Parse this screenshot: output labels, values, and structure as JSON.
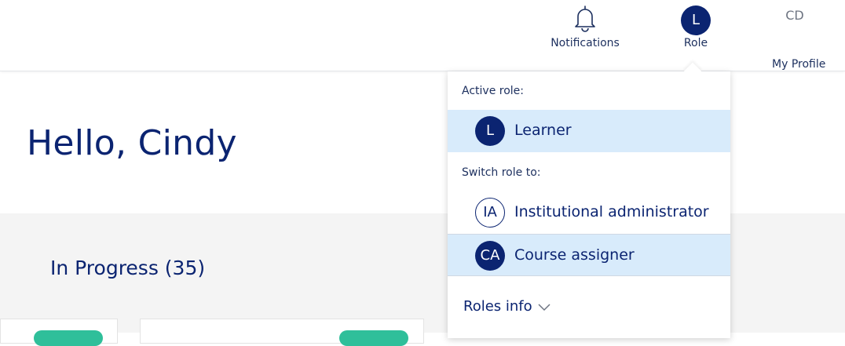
{
  "header": {
    "notifications_label": "Notifications",
    "role_initial": "L",
    "role_label": "Role",
    "profile_initials": "CD",
    "profile_label": "My Profile"
  },
  "greeting": "Hello, Cindy",
  "in_progress": {
    "title": "In Progress (35)"
  },
  "role_menu": {
    "active_heading": "Active role:",
    "active_role": {
      "initials": "L",
      "label": "Learner"
    },
    "switch_heading": "Switch role to:",
    "switch_roles": [
      {
        "initials": "IA",
        "label": "Institutional administrator"
      },
      {
        "initials": "CA",
        "label": "Course assigner"
      }
    ],
    "roles_info_label": "Roles info"
  },
  "colors": {
    "primary": "#0b2471",
    "selected_row": "#d8ebfb",
    "content_bg": "#f4f4f4",
    "badge": "#2fbf9a"
  }
}
